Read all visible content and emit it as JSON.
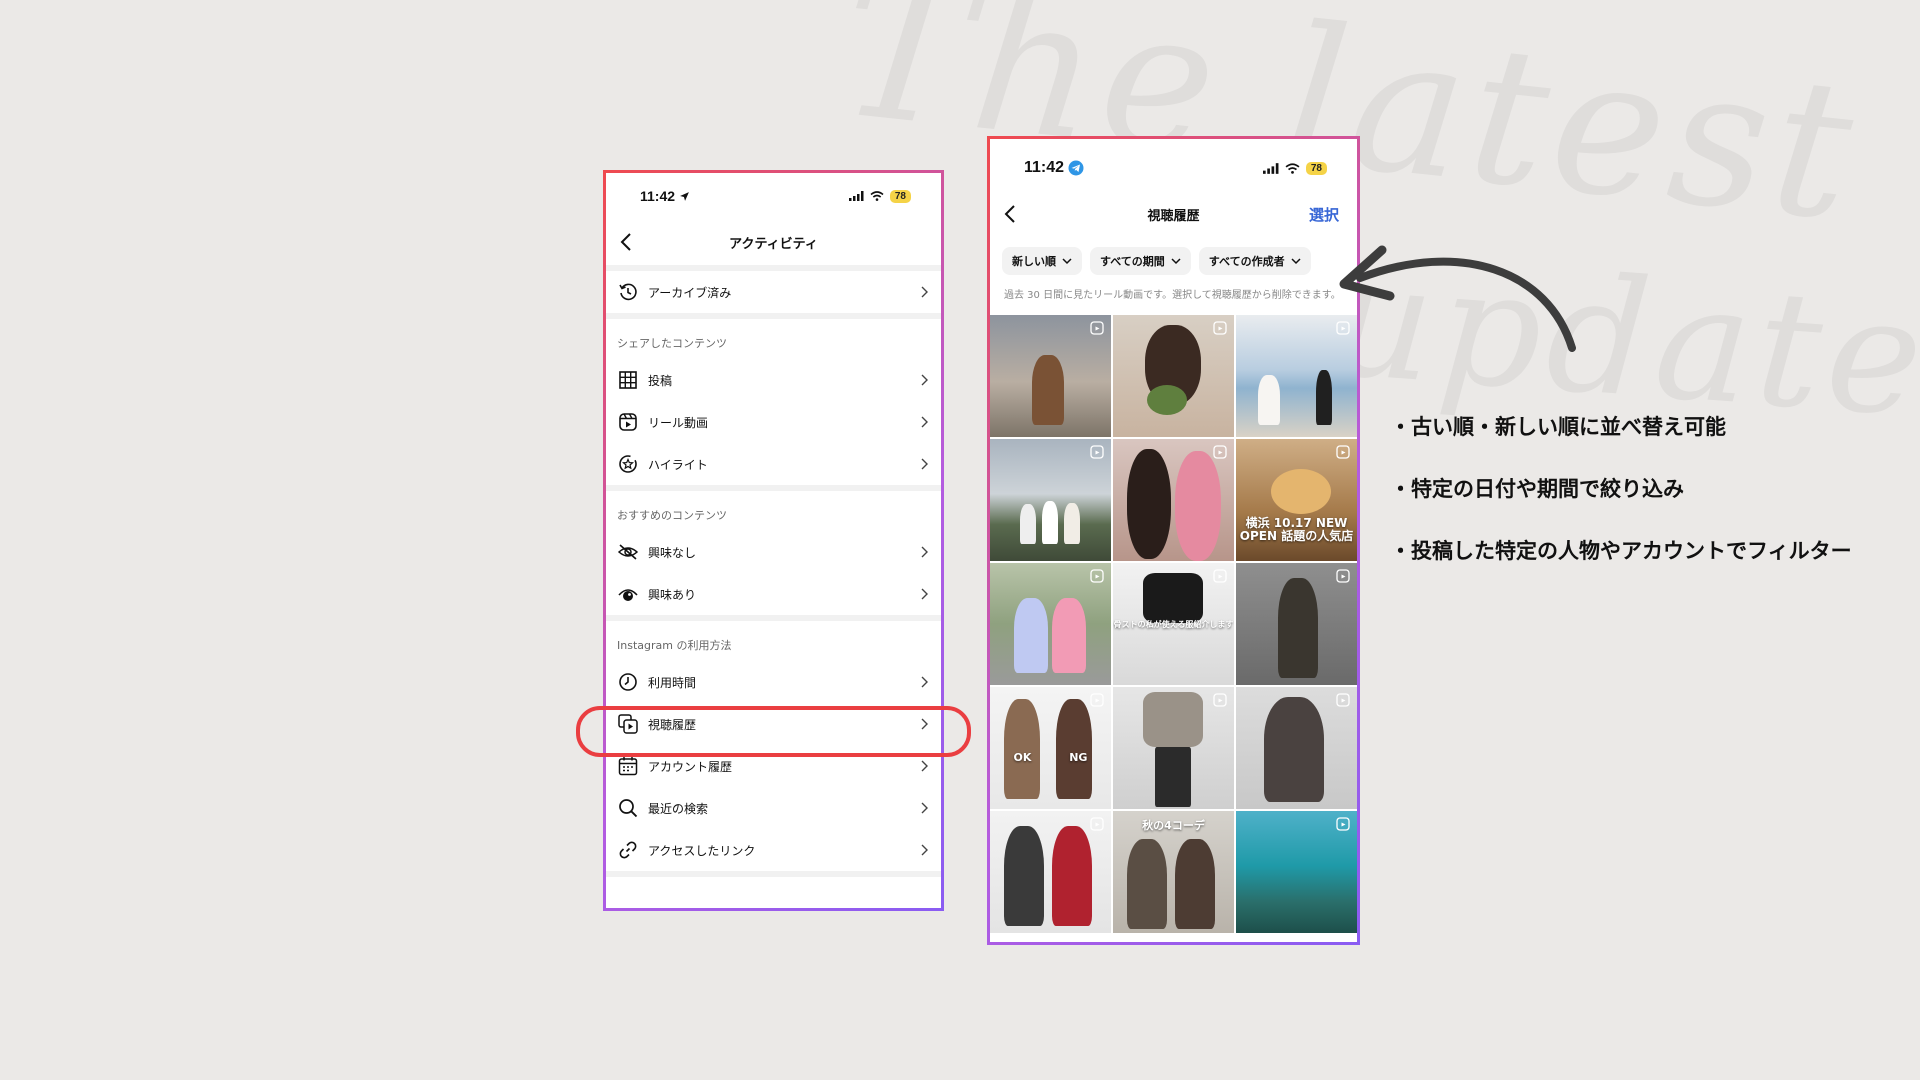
{
  "background": {
    "script_line_1": "The latest",
    "script_line_2": "update"
  },
  "colors": {
    "frame_gradient_start": "#ef4a4f",
    "frame_gradient_end": "#8a5cf2",
    "highlight": "#ea3e41",
    "link_blue": "#3867d6",
    "battery": "#f5d347"
  },
  "phone1": {
    "status": {
      "time": "11:42",
      "battery": "78"
    },
    "header": {
      "title": "アクティビティ"
    },
    "archive": {
      "label": "アーカイブ済み",
      "icon": "history-icon"
    },
    "shared": {
      "label": "シェアしたコンテンツ",
      "items": [
        {
          "label": "投稿",
          "icon": "grid-icon"
        },
        {
          "label": "リール動画",
          "icon": "reels-icon"
        },
        {
          "label": "ハイライト",
          "icon": "highlight-icon"
        }
      ]
    },
    "recommended": {
      "label": "おすすめのコンテンツ",
      "items": [
        {
          "label": "興味なし",
          "icon": "eye-off-icon"
        },
        {
          "label": "興味あり",
          "icon": "eye-icon"
        }
      ]
    },
    "usage": {
      "label": "Instagram の利用方法",
      "items": [
        {
          "label": "利用時間",
          "icon": "clock-icon"
        },
        {
          "label": "視聴履歴",
          "icon": "watch-history-icon"
        },
        {
          "label": "アカウント履歴",
          "icon": "calendar-icon"
        },
        {
          "label": "最近の検索",
          "icon": "search-icon"
        },
        {
          "label": "アクセスしたリンク",
          "icon": "link-icon"
        }
      ]
    }
  },
  "phone2": {
    "status": {
      "time": "11:42",
      "battery": "78"
    },
    "header": {
      "title": "視聴履歴",
      "action": "選択"
    },
    "filters": [
      "新しい順",
      "すべての期間",
      "すべての作成者"
    ],
    "helper": "過去 30 日間に見たリール動画です。選択して視聴履歴から削除できます。",
    "thumbs": [
      {
        "caption": ""
      },
      {
        "caption": ""
      },
      {
        "caption": ""
      },
      {
        "caption": ""
      },
      {
        "caption": ""
      },
      {
        "caption": "横浜 10.17 NEW OPEN 話題の人気店"
      },
      {
        "caption": ""
      },
      {
        "caption": "骨ストの私が使える服紹介します"
      },
      {
        "caption": ""
      },
      {
        "caption": "OK NG"
      },
      {
        "caption": ""
      },
      {
        "caption": ""
      },
      {
        "caption": ""
      },
      {
        "caption": "秋の4コーデ"
      },
      {
        "caption": ""
      }
    ]
  },
  "bullets": [
    "・古い順・新しい順に並べ替え可能",
    "・特定の日付や期間で絞り込み",
    "・投稿した特定の人物やアカウントでフィルター"
  ]
}
